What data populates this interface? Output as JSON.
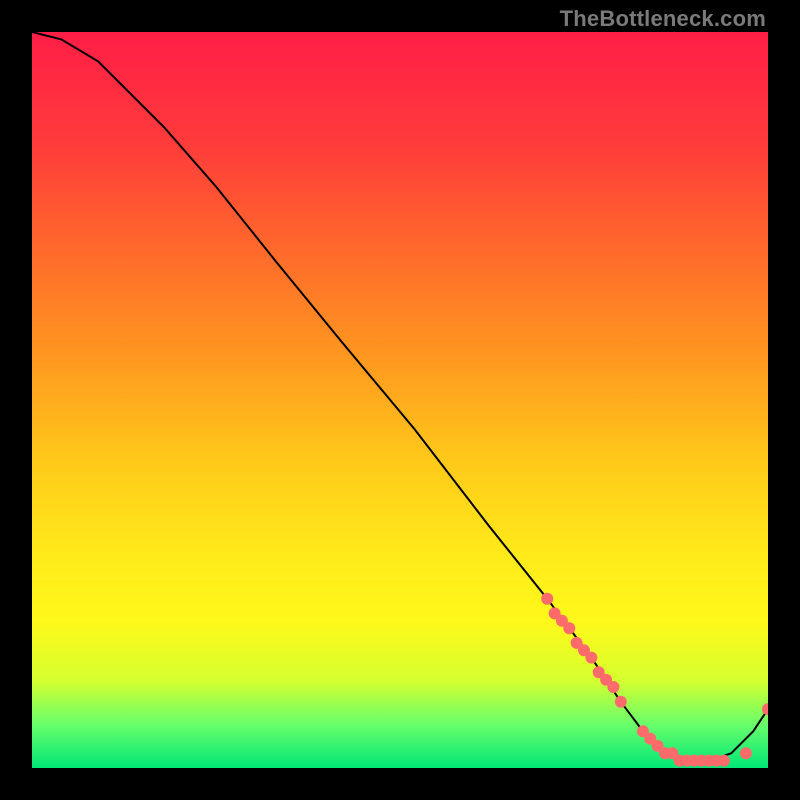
{
  "watermark": "TheBottleneck.com",
  "gradient_stops": [
    {
      "offset": 0,
      "color": "#ff1e46"
    },
    {
      "offset": 0.15,
      "color": "#ff3b3b"
    },
    {
      "offset": 0.3,
      "color": "#ff6a2b"
    },
    {
      "offset": 0.45,
      "color": "#ff9a1f"
    },
    {
      "offset": 0.58,
      "color": "#ffc81a"
    },
    {
      "offset": 0.7,
      "color": "#ffe81a"
    },
    {
      "offset": 0.8,
      "color": "#fff81a"
    },
    {
      "offset": 0.88,
      "color": "#d6ff2e"
    },
    {
      "offset": 0.94,
      "color": "#6aff6a"
    },
    {
      "offset": 1.0,
      "color": "#00e676"
    }
  ],
  "curve_color": "#000000",
  "point_color": "#ff6b6b",
  "chart_data": {
    "type": "line",
    "title": "",
    "xlabel": "",
    "ylabel": "",
    "xlim": [
      0,
      100
    ],
    "ylim": [
      0,
      100
    ],
    "series": [
      {
        "name": "bottleneck-curve",
        "x": [
          0,
          4,
          9,
          12,
          18,
          25,
          33,
          42,
          52,
          62,
          70,
          76,
          80,
          83,
          86,
          89,
          92,
          95,
          98,
          100
        ],
        "y": [
          100,
          99,
          96,
          93,
          87,
          79,
          69,
          58,
          46,
          33,
          23,
          15,
          9,
          5,
          2,
          1,
          1,
          2,
          5,
          8
        ]
      }
    ],
    "points": {
      "name": "highlighted-points",
      "x": [
        70,
        71,
        72,
        73,
        74,
        75,
        76,
        77,
        78,
        79,
        80,
        83,
        84,
        85,
        86,
        87,
        88,
        89,
        90,
        91,
        92,
        93,
        94,
        97,
        100
      ],
      "y": [
        23,
        21,
        20,
        19,
        17,
        16,
        15,
        13,
        12,
        11,
        9,
        5,
        4,
        3,
        2,
        2,
        1,
        1,
        1,
        1,
        1,
        1,
        1,
        2,
        8
      ]
    }
  }
}
